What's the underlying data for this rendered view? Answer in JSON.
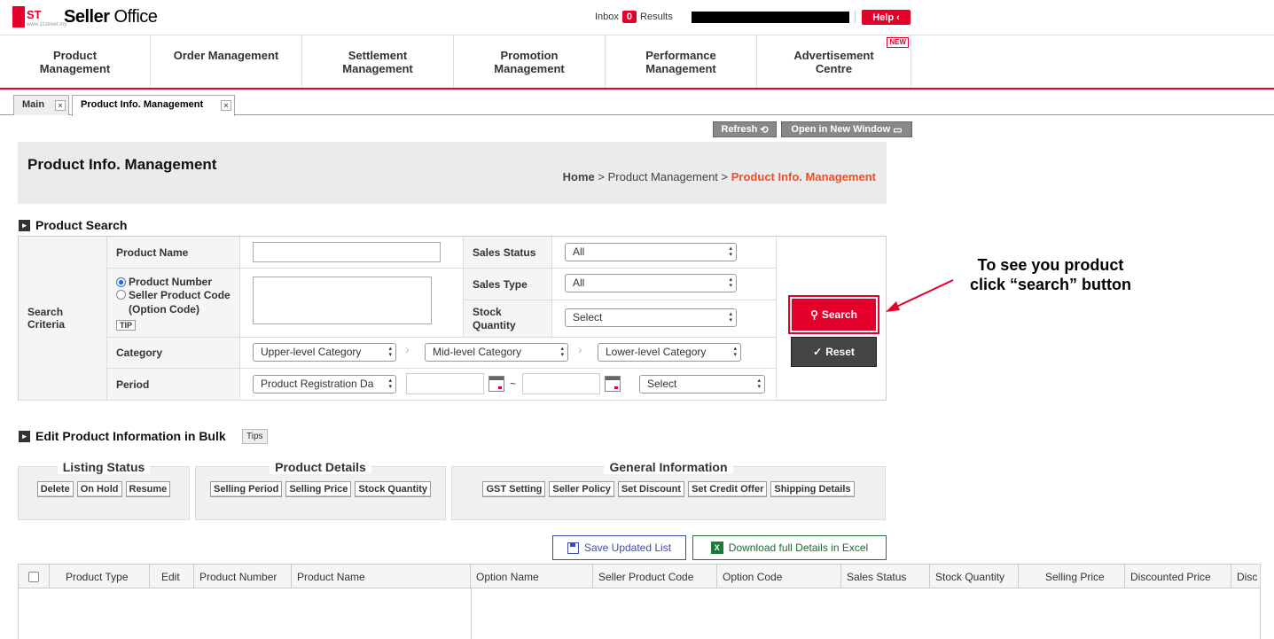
{
  "header": {
    "brand_prefix": "Seller",
    "brand_suffix": "Office",
    "logo_text": "ST",
    "logo_sub": "www.11street.my",
    "inbox_label": "Inbox",
    "inbox_count": "0",
    "results_label": "Results",
    "help_label": "Help"
  },
  "nav": {
    "items": [
      {
        "label": "Product\nManagement"
      },
      {
        "label": "Order Management"
      },
      {
        "label": "Settlement\nManagement"
      },
      {
        "label": "Promotion\nManagement"
      },
      {
        "label": "Performance\nManagement"
      },
      {
        "label": "Advertisement\nCentre"
      }
    ],
    "new_badge": "NEW"
  },
  "tabs": [
    {
      "label": "Main"
    },
    {
      "label": "Product Info. Management"
    }
  ],
  "toolbar": {
    "refresh_label": "Refresh",
    "open_new_window_label": "Open in New Window"
  },
  "title": {
    "page_title": "Product Info. Management",
    "bc_home": "Home",
    "bc_sep": ">",
    "bc_section": "Product Management",
    "bc_current": "Product Info. Management"
  },
  "search": {
    "heading": "Product Search",
    "criteria_label": "Search\nCriteria",
    "product_name_label": "Product Name",
    "product_number_label": "Product Number",
    "seller_code_label": "Seller Product Code\n(Option Code)",
    "tip_label": "TIP",
    "category_label": "Category",
    "period_label": "Period",
    "sales_status_label": "Sales Status",
    "sales_status_value": "All",
    "sales_type_label": "Sales Type",
    "sales_type_value": "All",
    "stock_quantity_label": "Stock\nQuantity",
    "stock_quantity_value": "Select",
    "upper_category": "Upper-level Category",
    "mid_category": "Mid-level Category",
    "lower_category": "Lower-level Category",
    "period_type": "Product Registration Da",
    "period_tilde": "~",
    "period_select": "Select",
    "search_button": "Search",
    "reset_button": "Reset"
  },
  "annotation": {
    "line1": "To see you product",
    "line2": "click “search” button"
  },
  "bulk": {
    "heading": "Edit Product Information in Bulk",
    "tips_label": "Tips",
    "groups": [
      {
        "title": "Listing Status",
        "buttons": [
          "Delete",
          "On Hold",
          "Resume"
        ]
      },
      {
        "title": "Product Details",
        "buttons": [
          "Selling Period",
          "Selling Price",
          "Stock Quantity"
        ]
      },
      {
        "title": "General Information",
        "buttons": [
          "GST Setting",
          "Seller Policy",
          "Set Discount",
          "Set Credit Offer",
          "Shipping Details"
        ]
      }
    ]
  },
  "actions": {
    "save_label": "Save Updated List",
    "excel_label": "Download full Details in Excel"
  },
  "grid": {
    "columns": [
      "Product Type",
      "Edit",
      "Product Number",
      "Product Name",
      "Option Name",
      "Seller Product Code",
      "Option Code",
      "Sales Status",
      "Stock Quantity",
      "Selling Price",
      "Discounted Price",
      "Disc"
    ]
  },
  "colors": {
    "brand_red": "#e4002b",
    "breadcrumb_accent": "#f04e23"
  }
}
